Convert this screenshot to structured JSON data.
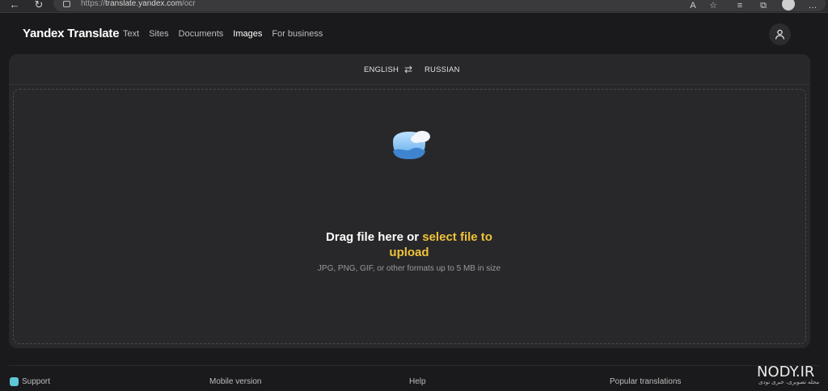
{
  "browser": {
    "url_scheme": "https://",
    "url_host": "translate.yandex.com",
    "url_path": "/ocr"
  },
  "header": {
    "logo": "Yandex Translate",
    "nav": [
      {
        "label": "Text",
        "active": false
      },
      {
        "label": "Sites",
        "active": false
      },
      {
        "label": "Documents",
        "active": false
      },
      {
        "label": "Images",
        "active": true
      },
      {
        "label": "For business",
        "active": false
      }
    ]
  },
  "translator": {
    "source_lang": "ENGLISH",
    "target_lang": "RUSSIAN"
  },
  "dropzone": {
    "title_prefix": "Drag file here or ",
    "title_link": "select file to upload",
    "subtitle": "JPG, PNG, GIF, or other formats up to 5 MB in size"
  },
  "footer": {
    "support": "Support",
    "mobile": "Mobile version",
    "help": "Help",
    "popular": "Popular translations"
  },
  "watermark": {
    "title": "NODY.IR",
    "subtitle": "مجله تصویری، خبری نودی"
  },
  "colors": {
    "accent_link": "#f0c23a",
    "background": "#1a1a1c",
    "panel": "#28282a"
  }
}
